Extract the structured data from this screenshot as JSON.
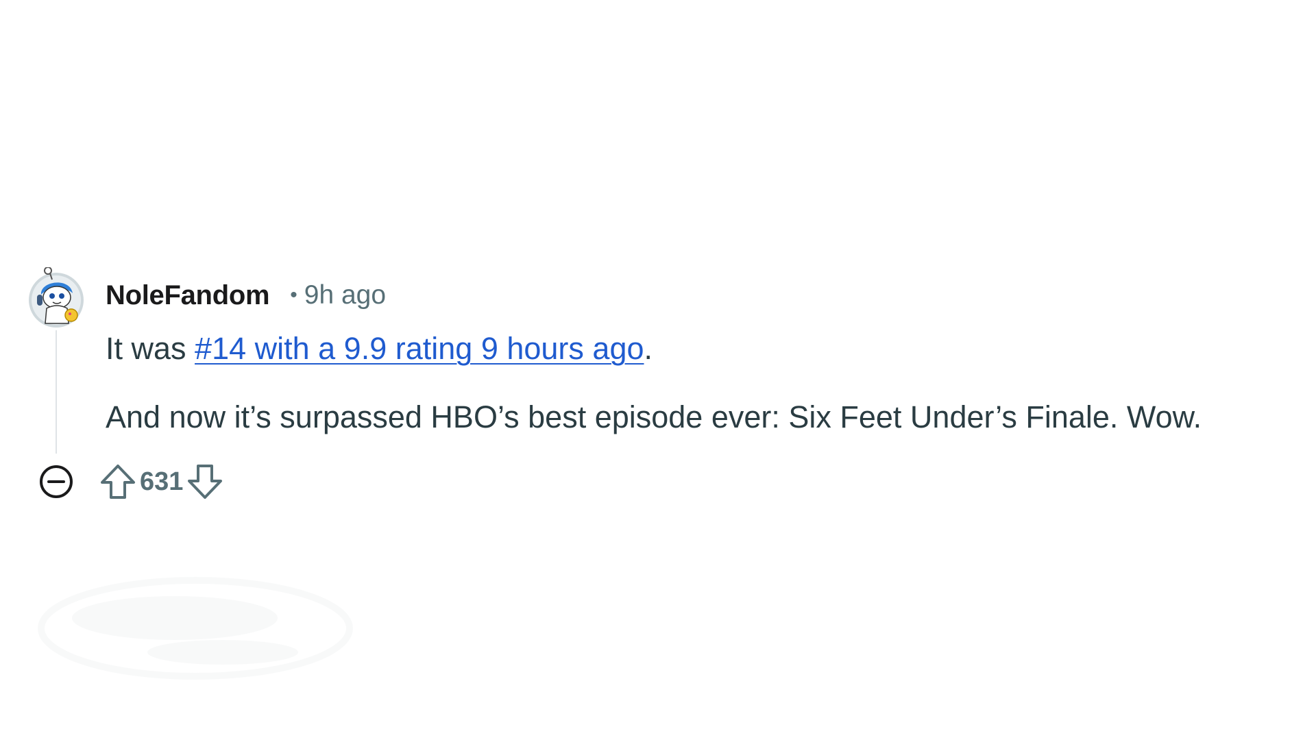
{
  "comment": {
    "author": "NoleFandom",
    "separator": "•",
    "timestamp": "9h ago",
    "body": {
      "line1_prefix": "It was ",
      "line1_link": "#14 with a 9.9 rating 9 hours ago",
      "line1_suffix": ".",
      "line2": "And now it’s surpassed HBO’s best episode ever: Six Feet Under’s Finale. Wow."
    },
    "score": "631"
  },
  "icons": {
    "avatar": "snoo-avatar-icon",
    "collapse": "collapse-minus-icon",
    "upvote": "upvote-arrow-icon",
    "downvote": "downvote-arrow-icon"
  },
  "colors": {
    "author": "#1a1a1b",
    "meta": "#576f76",
    "body_text": "#2a3c42",
    "link": "#1f5bcf",
    "thread_line": "#dfe3e6"
  }
}
